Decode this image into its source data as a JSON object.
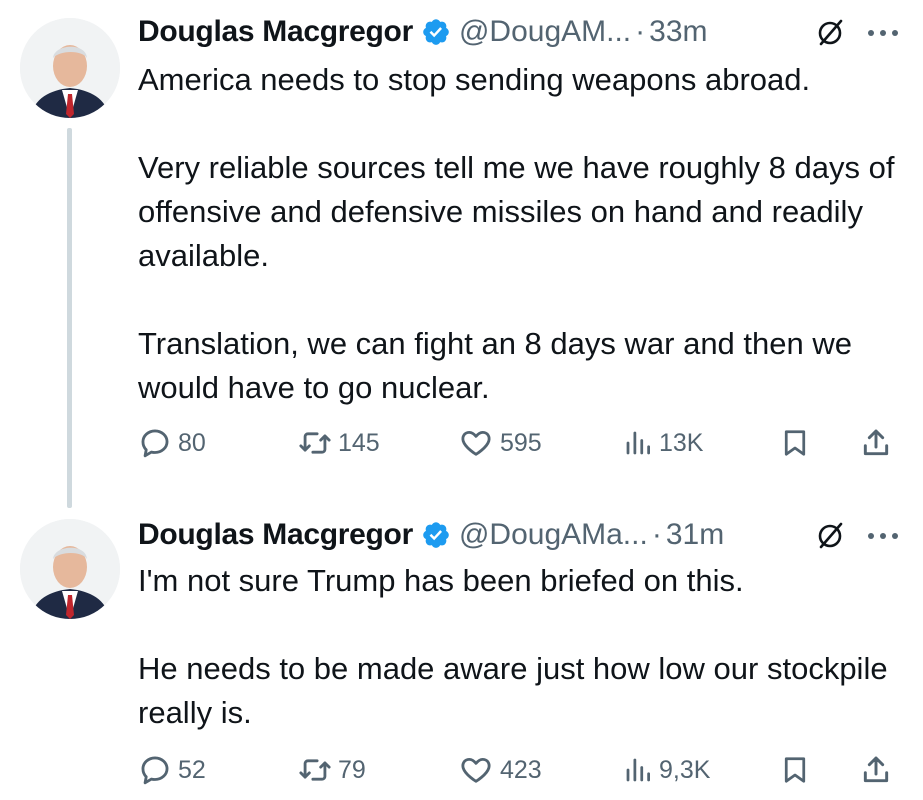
{
  "tweets": [
    {
      "author": "Douglas Macgregor",
      "handle": "@DougAM...",
      "time": "33m",
      "text": "America needs to stop sending weapons abroad.\n\nVery reliable sources tell me we have roughly 8 days of offensive and defensive missiles on hand and readily available.\n\nTranslation, we can fight an 8 days war and then we would have to go nuclear.",
      "replies": "80",
      "reposts": "145",
      "likes": "595",
      "views": "13K"
    },
    {
      "author": "Douglas Macgregor",
      "handle": "@DougAMa...",
      "time": "31m",
      "text": "I'm not sure Trump has been briefed on this.\n\nHe needs to be made aware just how low our stockpile really is.",
      "replies": "52",
      "reposts": "79",
      "likes": "423",
      "views": "9,3K"
    }
  ],
  "separator": "·",
  "colors": {
    "text": "#0f1419",
    "secondary": "#536471",
    "verified": "#1d9bf0",
    "thread_line": "#cfd9de"
  },
  "icons": [
    "verified-badge-icon",
    "grok-icon",
    "more-icon",
    "reply-icon",
    "repost-icon",
    "like-icon",
    "views-icon",
    "bookmark-icon",
    "share-icon"
  ]
}
